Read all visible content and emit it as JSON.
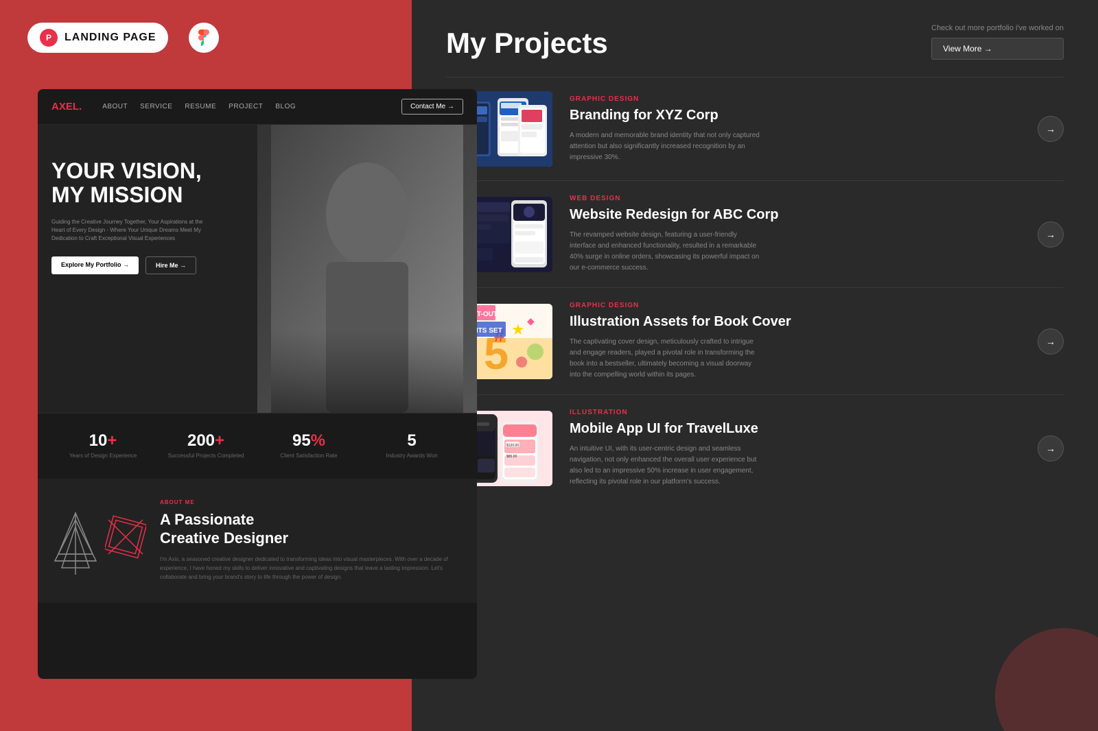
{
  "topbar": {
    "badge_label": "LANDING PAGE",
    "badge_icon": "P"
  },
  "left_panel": {
    "nav": {
      "brand": "AXEL.",
      "brand_accent": "A",
      "links": [
        "ABOUT",
        "SERVICE",
        "RESUME",
        "PROJECT",
        "BLOG"
      ],
      "contact_btn": "Contact Me →"
    },
    "hero": {
      "title_line1": "YOUR VISION,",
      "title_line2": "MY MISSION",
      "subtitle": "Guiding the Creative Journey Together, Your Aspirations at the Heart of Every Design - Where Your Unique Dreams Meet My Dedication to Craft Exceptional Visual Experiences",
      "btn_portfolio": "Explore My Portfolio →",
      "btn_hire": "Hire Me →"
    },
    "stats": [
      {
        "number": "10",
        "suffix": "+",
        "label": "Years of Design Experience"
      },
      {
        "number": "200",
        "suffix": "+",
        "label": "Successful Projects Completed"
      },
      {
        "number": "95",
        "suffix": "%",
        "label": "Client Satisfaction Rate"
      },
      {
        "number": "5",
        "suffix": "",
        "label": "Industry Awards Won"
      }
    ],
    "about": {
      "tag": "ABOUT ME",
      "title_line1": "A Passionate",
      "title_line2": "Creative Designer",
      "text": "I'm Axis, a seasoned creative designer dedicated to transforming ideas into visual masterpieces. With over a decade of experience, I have honed my skills to deliver innovative and captivating designs that leave a lasting impression. Let's collaborate and bring your brand's story to life through the power of design."
    }
  },
  "right_panel": {
    "title": "My Projects",
    "check_more": "Check out more portfolio i've worked on",
    "view_more_btn": "View More →",
    "projects": [
      {
        "category": "GRAPHIC DESIGN",
        "name": "Branding for XYZ Corp",
        "description": "A modern and memorable brand identity that not only captured attention but also significantly increased recognition by an impressive 30%.",
        "thumb_type": "1"
      },
      {
        "category": "WEB DESIGN",
        "name": "Website Redesign for ABC Corp",
        "description": "The revamped website design, featuring a user-friendly interface and enhanced functionality, resulted in a remarkable 40% surge in online orders, showcasing its powerful impact on our e-commerce success.",
        "thumb_type": "2"
      },
      {
        "category": "GRAPHIC DESIGN",
        "name": "Illustration Assets for Book Cover",
        "description": "The captivating cover design, meticulously crafted to intrigue and engage readers, played a pivotal role in transforming the book into a bestseller, ultimately becoming a visual doorway into the compelling world within its pages.",
        "thumb_type": "3"
      },
      {
        "category": "ILLUSTRATION",
        "name": "Mobile App UI for TravelLuxe",
        "description": "An intuitive UI, with its user-centric design and seamless navigation, not only enhanced the overall user experience but also led to an impressive 50% increase in user engagement, reflecting its pivotal role in our platform's success.",
        "thumb_type": "4"
      }
    ]
  }
}
